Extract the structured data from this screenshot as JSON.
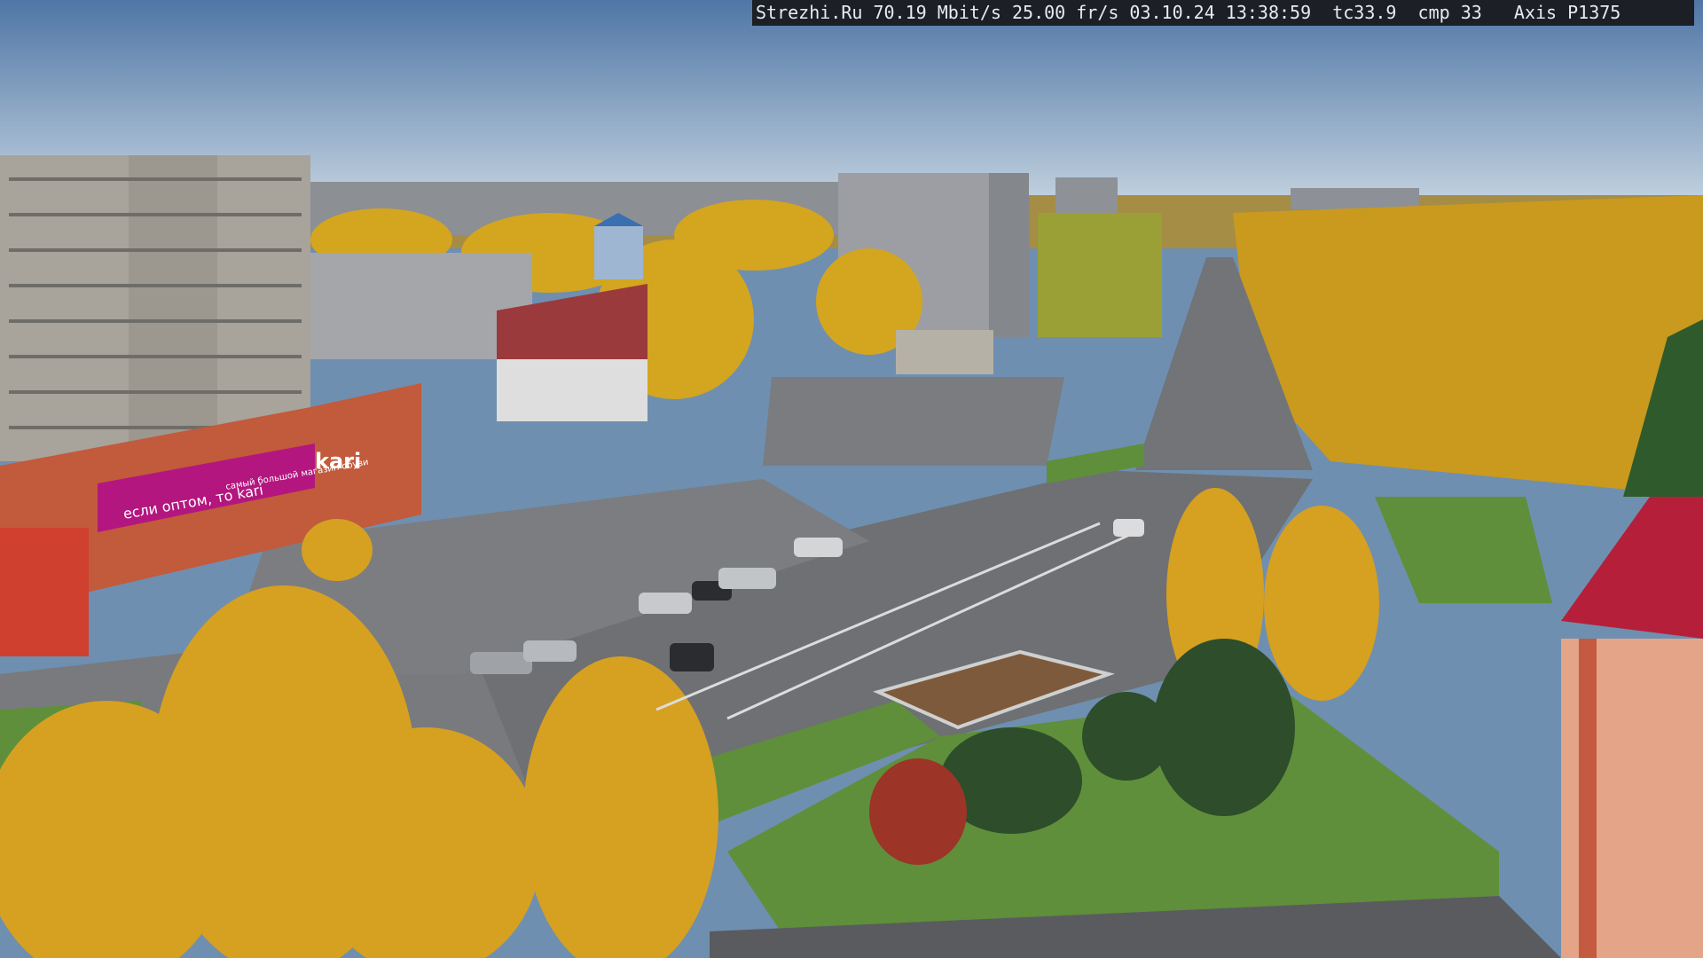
{
  "overlay": {
    "text": "Strezhi.Ru 70.19 Mbit/s 25.00 fr/s 03.10.24 13:38:59  tc33.9  cmp 33   Axis P1375"
  },
  "signs": {
    "store_brand": "kari",
    "store_slogan": "если оптом, то kari",
    "store_tagline": "самый большой магазин обуви"
  },
  "colors": {
    "sky_top": "#4f76a6",
    "sky_bottom": "#c8d6e2",
    "autumn_foliage": "#d4a51f",
    "brick_building": "#c25a3c",
    "store_magenta": "#b3177f",
    "grass": "#5f8f3a",
    "asphalt": "#6e7073"
  }
}
